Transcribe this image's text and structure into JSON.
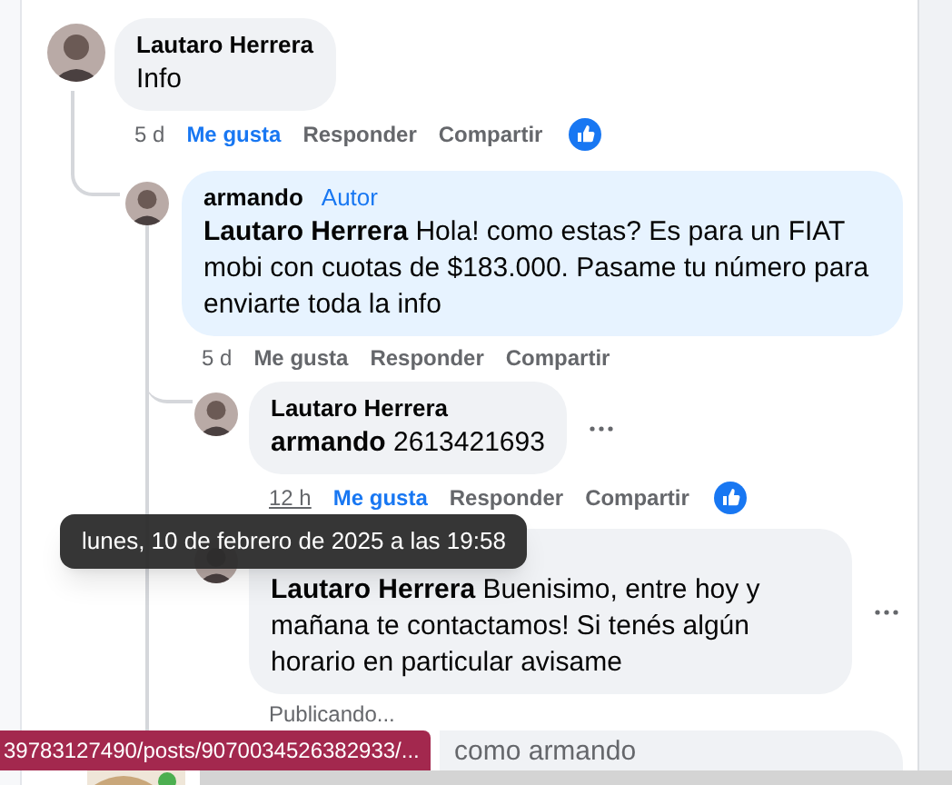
{
  "comments": [
    {
      "author": "Lautaro Herrera",
      "text": "Info",
      "time": "5 d",
      "like_label": "Me gusta",
      "liked": true,
      "reply_label": "Responder",
      "share_label": "Compartir",
      "reaction": true,
      "replies": [
        {
          "author": "armando",
          "badge": "Autor",
          "mention": "Lautaro Herrera",
          "text": "Hola! como estas? Es para un FIAT mobi con cuotas de $183.000. Pasame tu número para enviarte toda la info",
          "highlighted": true,
          "time": "5 d",
          "like_label": "Me gusta",
          "liked": false,
          "reply_label": "Responder",
          "share_label": "Compartir",
          "replies": [
            {
              "author": "Lautaro Herrera",
              "mention": "armando",
              "text": "2613421693",
              "time": "12 h",
              "time_hovered": true,
              "like_label": "Me gusta",
              "liked": true,
              "reply_label": "Responder",
              "share_label": "Compartir",
              "reaction": true,
              "more": true
            },
            {
              "mention": "Lautaro Herrera",
              "text": "Buenisimo, entre hoy y mañana te contactamos! Si tenés algún horario en particular avisame",
              "status": "Publicando...",
              "more": true
            }
          ]
        }
      ]
    }
  ],
  "composer": {
    "placeholder": "como armando"
  },
  "tooltip": {
    "text": "lunes, 10 de febrero de 2025 a las 19:58"
  },
  "status_url": {
    "text": "39783127490/posts/9070034526382933/..."
  }
}
